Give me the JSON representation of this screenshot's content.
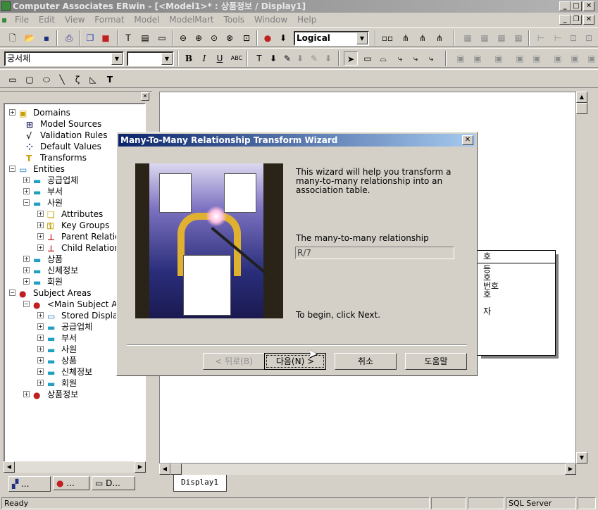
{
  "window": {
    "title": "Computer Associates ERwin - [<Model1>* : 상품정보 / Display1]"
  },
  "menu": [
    "File",
    "Edit",
    "View",
    "Format",
    "Model",
    "ModelMart",
    "Tools",
    "Window",
    "Help"
  ],
  "toolbar": {
    "view_mode": "Logical",
    "font_name": "궁서체",
    "font_size": ""
  },
  "tree": {
    "items": [
      {
        "label": "Domains",
        "icon": "domains-icon"
      },
      {
        "label": "Model Sources",
        "icon": "model-sources-icon"
      },
      {
        "label": "Validation Rules",
        "icon": "validation-rules-icon"
      },
      {
        "label": "Default Values",
        "icon": "default-values-icon"
      },
      {
        "label": "Transforms",
        "icon": "transforms-icon"
      },
      {
        "label": "Entities",
        "icon": "entities-icon"
      },
      {
        "label": "공급업체",
        "icon": "entity-icon"
      },
      {
        "label": "부서",
        "icon": "entity-icon"
      },
      {
        "label": "사원",
        "icon": "entity-icon"
      },
      {
        "label": "Attributes",
        "icon": "attributes-icon"
      },
      {
        "label": "Key Groups",
        "icon": "key-groups-icon"
      },
      {
        "label": "Parent Relatio",
        "icon": "parent-relation-icon"
      },
      {
        "label": "Child Relation",
        "icon": "child-relation-icon"
      },
      {
        "label": "상품",
        "icon": "entity-icon"
      },
      {
        "label": "신체정보",
        "icon": "entity-icon"
      },
      {
        "label": "회원",
        "icon": "entity-icon"
      },
      {
        "label": "Subject Areas",
        "icon": "subject-areas-icon"
      },
      {
        "label": "<Main Subject A",
        "icon": "subject-area-icon"
      },
      {
        "label": "Stored Displa",
        "icon": "stored-display-icon"
      },
      {
        "label": "공급업체",
        "icon": "entity-icon"
      },
      {
        "label": "부서",
        "icon": "entity-icon"
      },
      {
        "label": "사원",
        "icon": "entity-icon"
      },
      {
        "label": "상품",
        "icon": "entity-icon"
      },
      {
        "label": "신체정보",
        "icon": "entity-icon"
      },
      {
        "label": "회원",
        "icon": "entity-icon"
      },
      {
        "label": "상품정보",
        "icon": "subject-area-icon"
      }
    ],
    "tabs": [
      "...",
      "...",
      "D..."
    ]
  },
  "canvas": {
    "tab": "Display1",
    "entity_rows": [
      "호",
      "등",
      "호",
      "번호",
      "호",
      "자"
    ]
  },
  "dialog": {
    "title": "Many-To-Many Relationship Transform Wizard",
    "intro": "This wizard will help you transform a many-to-many relationship into an association table.",
    "relationship_label": "The many-to-many relationship",
    "relationship_value": "R/7",
    "begin_text": "To begin, click Next.",
    "back_button": "< 뒤로(B)",
    "next_button": "다음(N) >",
    "cancel_button": "취소",
    "help_button": "도움말"
  },
  "status": {
    "left": "Ready",
    "db": "SQL Server"
  }
}
